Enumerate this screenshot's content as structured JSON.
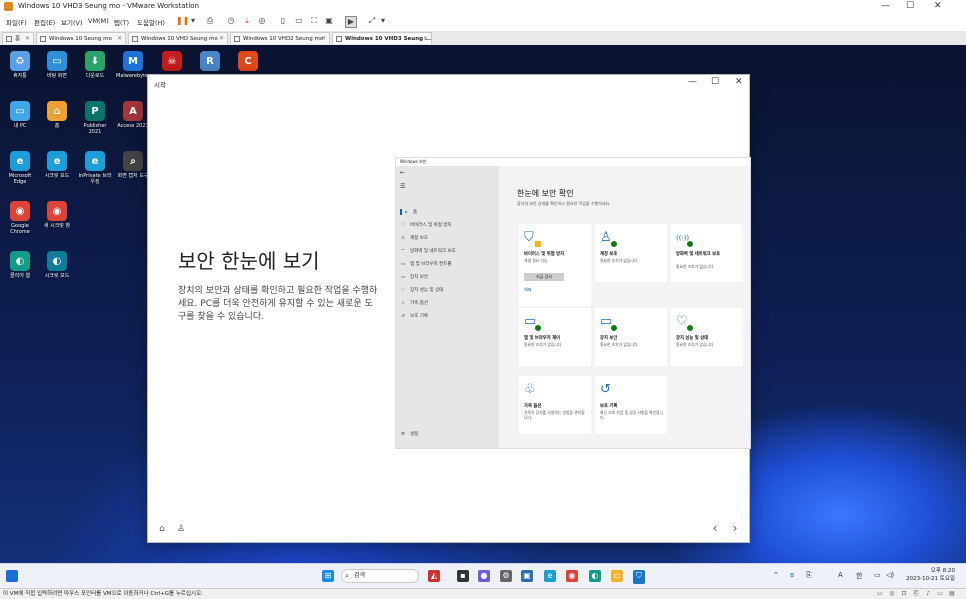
{
  "window": {
    "title": "Windows 10 VHD3 Seung mo - VMware Workstation",
    "minimize": "—",
    "maximize": "☐",
    "close": "✕"
  },
  "menu": {
    "items": [
      "파일(F)",
      "편집(E)",
      "보기(V)",
      "VM(M)",
      "탭(T)",
      "도움말(H)"
    ]
  },
  "tabs": [
    {
      "label": "홈",
      "active": false
    },
    {
      "label": "Windows 10 Seung mo",
      "active": false
    },
    {
      "label": "Windows 10 VHD Seung mo",
      "active": false
    },
    {
      "label": "Windows 10 VHD2 Seung mo",
      "active": false
    },
    {
      "label": "Windows 10 VHD3 Seung ...",
      "active": true
    }
  ],
  "desktop_icons": [
    {
      "label": "휴지통",
      "icon": "recycle-bin-icon",
      "color": "#5aa0e6",
      "glyph": "♻"
    },
    {
      "label": "바탕 화면",
      "icon": "folder-icon",
      "color": "#2f8fd8",
      "glyph": "▭"
    },
    {
      "label": "다운로드",
      "icon": "download-icon",
      "color": "#2aa36a",
      "glyph": "⬇"
    },
    {
      "label": "Malwarebytes",
      "icon": "malwarebytes-icon",
      "color": "#1e73d8",
      "glyph": "M"
    },
    {
      "label": "",
      "icon": "game-icon",
      "color": "#c51d1d",
      "glyph": "☠"
    },
    {
      "label": "",
      "icon": "recuva-icon",
      "color": "#4a86c7",
      "glyph": "R"
    },
    {
      "label": "",
      "icon": "ccleaner-icon",
      "color": "#e04a1c",
      "glyph": "C"
    },
    {
      "label": "내 PC",
      "icon": "computer-icon",
      "color": "#3fa7e8",
      "glyph": "▭"
    },
    {
      "label": "홈",
      "icon": "home-icon",
      "color": "#f0a030",
      "glyph": "⌂"
    },
    {
      "label": "Publisher 2021",
      "icon": "publisher-icon",
      "color": "#077568",
      "glyph": "P"
    },
    {
      "label": "Access 2021",
      "icon": "access-icon",
      "color": "#a4373a",
      "glyph": "A"
    },
    {
      "label": "Microsoft Edge",
      "icon": "edge-icon",
      "color": "#1c9fd8",
      "glyph": "e"
    },
    {
      "label": "시크릿 모드",
      "icon": "edge-inprivate-icon",
      "color": "#1c9fd8",
      "glyph": "e"
    },
    {
      "label": "InPrivate 브라우징",
      "icon": "edge-private-icon",
      "color": "#1c9fd8",
      "glyph": "e"
    },
    {
      "label": "화면 캡처 도구",
      "icon": "snipping-icon",
      "color": "#444",
      "glyph": "⌕"
    },
    {
      "label": "Google Chrome",
      "icon": "chrome-icon",
      "color": "#db4437",
      "glyph": "◉"
    },
    {
      "label": "새 시크릿 창",
      "icon": "chrome-incognito-icon",
      "color": "#db4437",
      "glyph": "◉"
    },
    {
      "label": "클리어 웹",
      "icon": "app-icon",
      "color": "#0f9d8a",
      "glyph": "◐"
    },
    {
      "label": "시크릿 모드",
      "icon": "app2-icon",
      "color": "#0f7d9a",
      "glyph": "◐"
    }
  ],
  "start_dialog": {
    "title": "시작",
    "hero_title": "보안 한눈에 보기",
    "hero_desc": "장치의 보안과 상태를 확인하고 필요한 작업을 수행하세요. PC를 더욱 안전하게 유지할 수 있는 새로운 도구를 찾을 수 있습니다.",
    "home_icon": "⌂",
    "person_icon": "♙",
    "prev": "‹",
    "next": "›"
  },
  "security": {
    "app_title": "Windows 보안",
    "back": "←",
    "menu": "☰",
    "nav": [
      {
        "label": "홈",
        "glyph": "⌂"
      },
      {
        "label": "바이러스 및 위협 방지",
        "glyph": "♡"
      },
      {
        "label": "계정 보호",
        "glyph": "♙"
      },
      {
        "label": "방화벽 및 네트워크 보호",
        "glyph": "⌔"
      },
      {
        "label": "앱 및 브라우저 컨트롤",
        "glyph": "▭"
      },
      {
        "label": "장치 보안",
        "glyph": "▭"
      },
      {
        "label": "장치 성능 및 상태",
        "glyph": "♡"
      },
      {
        "label": "가족 옵션",
        "glyph": "♧"
      },
      {
        "label": "보호 기록",
        "glyph": "↺"
      }
    ],
    "settings": {
      "label": "설정",
      "glyph": "⚙"
    },
    "heading": "한눈에 보안 확인",
    "subheading": "장치의 보안 상태를 확인하고 필요한 작업을 수행하세요.",
    "cards": [
      {
        "title": "바이러스 및 위협 방지",
        "status": "해결 필요 기능.",
        "glyph": "⛉",
        "warn": true,
        "button": "지금 검사",
        "link": "해제"
      },
      {
        "title": "계정 보호",
        "status": "필요한 조치가 없습니다.",
        "glyph": "♙",
        "warn": false
      },
      {
        "title": "방화벽 및 네트워크 보호",
        "status": "필요한 조치가 없습니다.",
        "glyph": "((·))",
        "warn": false
      },
      {
        "title": "앱 및 브라우저 제어",
        "status": "필요한 조치가 없습니다.",
        "glyph": "▭",
        "warn": false
      },
      {
        "title": "장치 보안",
        "status": "필요한 조치가 없습니다.",
        "glyph": "▭",
        "warn": false
      },
      {
        "title": "장치 성능 및 상태",
        "status": "필요한 조치가 없습니다.",
        "glyph": "♡",
        "warn": false
      },
      {
        "title": "가족 옵션",
        "status": "가족이 장치를 사용하는 방법을 관리합니다.",
        "glyph": "♧",
        "warn": null
      },
      {
        "title": "보호 기록",
        "status": "최신 보호 작업 및 권장 사항을 확인합니다.",
        "glyph": "↺",
        "warn": null
      }
    ]
  },
  "taskbar": {
    "search_placeholder": "검색",
    "clock_time": "오후 8:20",
    "clock_date": "2023-10-21 토요일",
    "ime": "A",
    "lang": "한"
  },
  "statusbar": {
    "text": "이 VM에 직접 입력하려면 마우스 포인터를 VM으로 이동하거나 Ctrl+G를 누르십시오."
  }
}
